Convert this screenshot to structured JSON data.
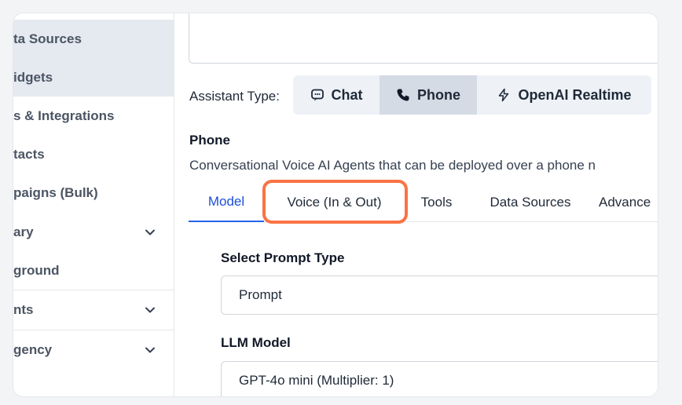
{
  "sidebar": {
    "items": [
      {
        "label": "ta Sources",
        "active": true
      },
      {
        "label": "idgets",
        "active": true
      },
      {
        "label": "s & Integrations"
      },
      {
        "label": "tacts"
      },
      {
        "label": "paigns (Bulk)"
      },
      {
        "label": "ary",
        "chevron": "chevron-down-icon"
      },
      {
        "label": "ground"
      },
      {
        "label": "nts",
        "chevron": "chevron-down-icon"
      },
      {
        "label": "gency",
        "chevron": "chevron-down-icon"
      }
    ]
  },
  "assistant_type": {
    "label": "Assistant Type:",
    "options": [
      {
        "label": "Chat",
        "icon": "chat-icon"
      },
      {
        "label": "Phone",
        "icon": "phone-icon",
        "selected": true
      },
      {
        "label": "OpenAI Realtime",
        "icon": "lightning-icon"
      }
    ]
  },
  "section": {
    "title": "Phone",
    "description": "Conversational Voice AI Agents that can be deployed over a phone n"
  },
  "tabs": [
    {
      "label": "Model",
      "active": true
    },
    {
      "label": "Voice (In & Out)"
    },
    {
      "label": "Tools"
    },
    {
      "label": "Data Sources"
    },
    {
      "label": "Advance"
    }
  ],
  "form": {
    "prompt_type_label": "Select Prompt Type",
    "prompt_type_value": "Prompt",
    "llm_model_label": "LLM Model",
    "llm_model_value": "GPT-4o mini (Multiplier: 1)"
  },
  "colors": {
    "accent": "#2563eb",
    "highlight": "#f97345",
    "selected_segment": "#d5dbe4"
  }
}
